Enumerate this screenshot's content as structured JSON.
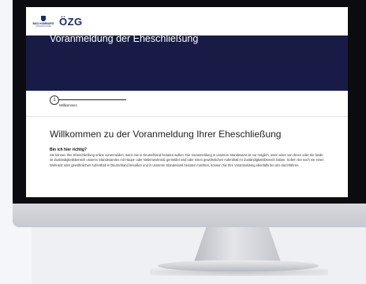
{
  "site": {
    "city_logo_name": "BAD HOMBURG",
    "city_logo_sub": "VOR DER HÖHE",
    "ozg_logo": "ÖZG",
    "crest_color": "#1a2b6d"
  },
  "hero": {
    "title": "Voranmeldung der Eheschließung",
    "background": "#171b45"
  },
  "stepper": {
    "step_number": "1",
    "step_label": "Willkommen"
  },
  "main": {
    "title": "Willkommen zu der Voranmeldung Ihrer Eheschließung",
    "section_heading": "Bin ich hier richtig?",
    "body": "Sie können Ihre Eheschließung online voranmelden, wenn Sie in Deutschland heiraten wollen. Die Voranmeldung in unserem Standesamt ist nur möglich, wenn einer von Ihnen oder Sie beide im Zuständigkeitsbereich unseres Standesamtes mit Haupt- oder Nebenwohnsitz gemeldet sind oder einen gewöhnlichen Aufenthalt im Zuständigkeitsbereich haben. Sofern Sie noch nie einen Wohnsitz oder gewöhnlichen Aufenthalt in Deutschland besaßen und in unserem Standesamt heiraten möchten, können Sie Ihre Voranmeldung ebenfalls bei uns durchführen."
  }
}
